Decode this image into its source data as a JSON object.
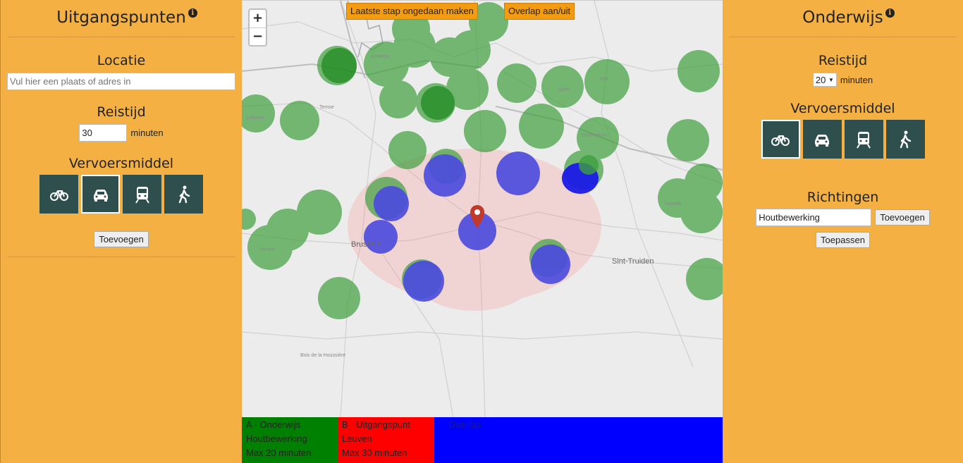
{
  "left_panel": {
    "title": "Uitgangspunten",
    "location_heading": "Locatie",
    "location_placeholder": "Vul hier een plaats of adres in",
    "travel_time_heading": "Reistijd",
    "travel_time_value": "30",
    "minutes_label": "minuten",
    "transport_heading": "Vervoersmiddel",
    "modes": [
      {
        "name": "bicycle-icon",
        "active": false
      },
      {
        "name": "car-icon",
        "active": true
      },
      {
        "name": "train-icon",
        "active": false
      },
      {
        "name": "walk-icon",
        "active": false
      }
    ],
    "add_button": "Toevoegen"
  },
  "right_panel": {
    "title": "Onderwijs",
    "travel_time_heading": "Reistijd",
    "travel_time_selected": "20",
    "minutes_label": "minuten",
    "transport_heading": "Vervoersmiddel",
    "modes": [
      {
        "name": "bicycle-icon",
        "active": true
      },
      {
        "name": "car-icon",
        "active": false
      },
      {
        "name": "train-icon",
        "active": false
      },
      {
        "name": "walk-icon",
        "active": false
      }
    ],
    "directions_heading": "Richtingen",
    "direction_value": "Houtbewerking",
    "add_button": "Toevoegen",
    "apply_button": "Toepassen"
  },
  "map": {
    "zoom_in": "+",
    "zoom_out": "−",
    "undo_button": "Laatste stap ongedaan maken",
    "overlap_button": "Overlap aan/uit",
    "place_labels": {
      "antwerp": "Antwerp",
      "brussels": "Brussels",
      "lokeren": "Lokeren",
      "temse": "Temse",
      "geel": "Geel",
      "mol": "Mol",
      "tessenderlo": "Tessenderlo",
      "hasselt": "Hasselt",
      "sint_truiden": "Sint-Truiden",
      "ninove": "Ninove",
      "bois": "Bois de la Houssière"
    }
  },
  "legend": {
    "a": {
      "line1": "A - Onderwijs",
      "line2": "Houtbewerking",
      "line3": "Max 20 minuten"
    },
    "b": {
      "line1": "B - Uitgangspunt",
      "line2": "Leuven",
      "line3": "Max 30 minuten"
    },
    "c": {
      "line1": "Overlap"
    }
  },
  "colors": {
    "panel": "#f4b042",
    "green": "#008000",
    "red": "#ff0000",
    "blue": "#0000ff",
    "mode_button": "#2f4f4f"
  }
}
